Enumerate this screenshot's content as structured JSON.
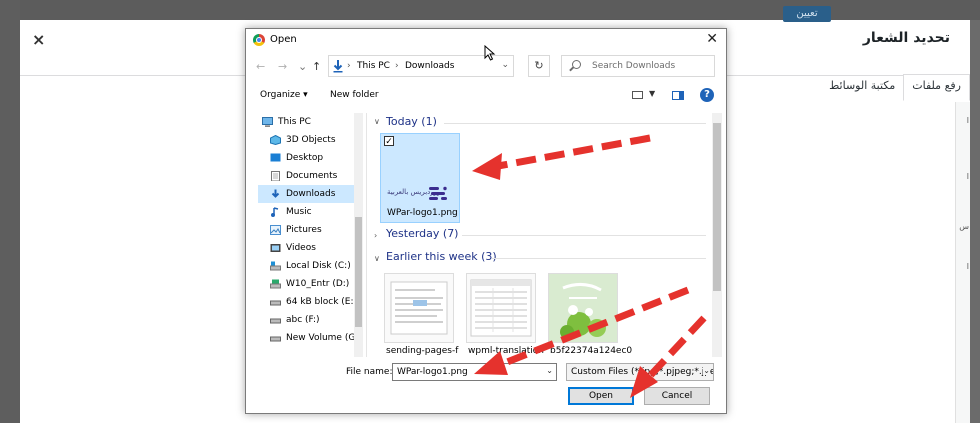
{
  "wordpress": {
    "title": "تحديد الشعار",
    "close": "×",
    "tabs": [
      {
        "label": "رفع ملفات",
        "active": true
      },
      {
        "label": "مكتبة الوسائط",
        "active": false
      }
    ],
    "top_button": "تعيين"
  },
  "dialog": {
    "app_icon": "chrome-icon",
    "title": "Open",
    "close": "✕",
    "breadcrumb": [
      "This PC",
      "Downloads"
    ],
    "search_placeholder": "Search Downloads",
    "toolbar": {
      "organize": "Organize ▾",
      "new_folder": "New folder"
    },
    "nav_items": [
      {
        "label": "This PC",
        "icon": "computer-icon",
        "selected": false
      },
      {
        "label": "3D Objects",
        "icon": "3d-objects-icon",
        "selected": false
      },
      {
        "label": "Desktop",
        "icon": "desktop-icon",
        "selected": false
      },
      {
        "label": "Documents",
        "icon": "documents-icon",
        "selected": false
      },
      {
        "label": "Downloads",
        "icon": "downloads-icon",
        "selected": true
      },
      {
        "label": "Music",
        "icon": "music-icon",
        "selected": false
      },
      {
        "label": "Pictures",
        "icon": "pictures-icon",
        "selected": false
      },
      {
        "label": "Videos",
        "icon": "videos-icon",
        "selected": false
      },
      {
        "label": "Local Disk (C:)",
        "icon": "local-disk-icon",
        "selected": false
      },
      {
        "label": "W10_Entr (D:)",
        "icon": "drive-icon",
        "selected": false
      },
      {
        "label": "64 kB block (E:)",
        "icon": "drive-icon",
        "selected": false
      },
      {
        "label": "abc (F:)",
        "icon": "drive-icon",
        "selected": false
      },
      {
        "label": "New Volume (G:",
        "icon": "drive-icon",
        "selected": false
      }
    ],
    "groups": {
      "today": "Today (1)",
      "yesterday": "Yesterday (7)",
      "earlier": "Earlier this week (3)"
    },
    "files": {
      "selected": "WPar-logo1.png",
      "earlier": [
        "sending-pages-f",
        "wpml-translation",
        "b5f22374a124ec0"
      ]
    },
    "footer": {
      "file_name_label": "File name:",
      "file_name_value": "WPar-logo1.png",
      "file_type": "Custom Files (*.jpg;*.pjpeg;*.jpe",
      "open": "Open",
      "cancel": "Cancel"
    },
    "logo_text": "ووردبريس بالعربية"
  },
  "colors": {
    "arrow": "#e5322d",
    "selection": "#cce8ff",
    "accent": "#0078d7",
    "group_text": "#1e3287"
  }
}
